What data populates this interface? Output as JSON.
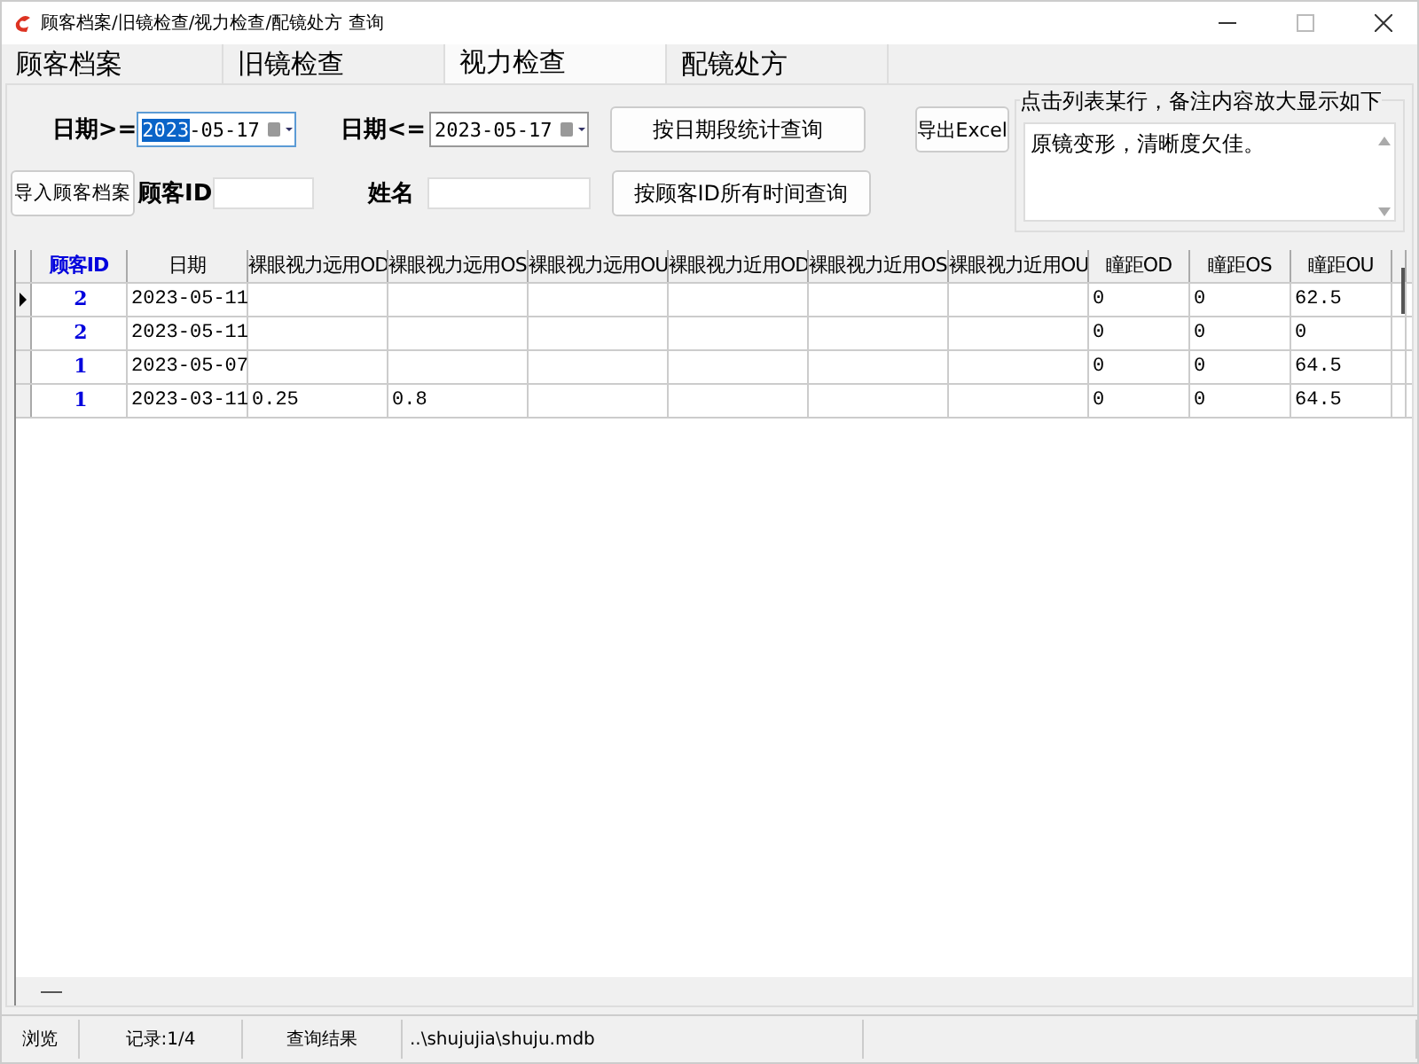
{
  "window": {
    "title": "顾客档案/旧镜检查/视力检查/配镜处方  查询"
  },
  "tabs": [
    {
      "label": "顾客档案",
      "selected": false
    },
    {
      "label": "旧镜检查",
      "selected": false
    },
    {
      "label": "视力检查",
      "selected": true
    },
    {
      "label": "配镜处方",
      "selected": false
    }
  ],
  "form": {
    "date_from_label": "日期>=",
    "date_from": {
      "highlight": "2023",
      "rest": "-05-17"
    },
    "date_to_label": "日期<=",
    "date_to": "2023-05-17",
    "query_by_date": "按日期段统计查询",
    "export": "导出Excel",
    "import": "导入顾客档案",
    "customer_id_label": "顾客ID",
    "name_label": "姓名",
    "query_by_id": "按顾客ID所有时间查询"
  },
  "note": {
    "legend": "点击列表某行，备注内容放大显示如下",
    "text": "原镜变形，清晰度欠佳。"
  },
  "table": {
    "columns": [
      "顾客ID",
      "日期",
      "裸眼视力远用OD",
      "裸眼视力远用OS",
      "裸眼视力远用OU",
      "裸眼视力近用OD",
      "裸眼视力近用OS",
      "裸眼视力近用OU",
      "瞳距OD",
      "瞳距OS",
      "瞳距OU"
    ],
    "rows": [
      {
        "selected": true,
        "cells": [
          "2",
          "2023-05-11",
          "",
          "",
          "",
          "",
          "",
          "",
          "0",
          "0",
          "62.5"
        ]
      },
      {
        "selected": false,
        "cells": [
          "2",
          "2023-05-11",
          "",
          "",
          "",
          "",
          "",
          "",
          "0",
          "0",
          "0"
        ]
      },
      {
        "selected": false,
        "cells": [
          "1",
          "2023-05-07",
          "",
          "",
          "",
          "",
          "",
          "",
          "0",
          "0",
          "64.5"
        ]
      },
      {
        "selected": false,
        "cells": [
          "1",
          "2023-03-11",
          "0.25",
          "0.8",
          "",
          "",
          "",
          "",
          "0",
          "0",
          "64.5"
        ]
      }
    ]
  },
  "status_bar": [
    "浏览",
    "记录:1/4",
    "查询结果",
    "..\\shujujia\\shuju.mdb"
  ]
}
